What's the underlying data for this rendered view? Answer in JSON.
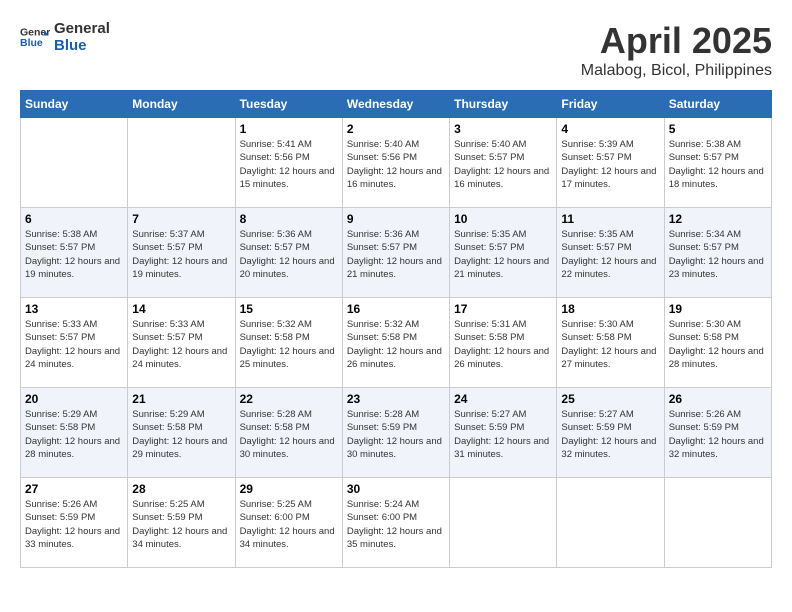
{
  "header": {
    "logo_line1": "General",
    "logo_line2": "Blue",
    "month_year": "April 2025",
    "location": "Malabog, Bicol, Philippines"
  },
  "weekdays": [
    "Sunday",
    "Monday",
    "Tuesday",
    "Wednesday",
    "Thursday",
    "Friday",
    "Saturday"
  ],
  "weeks": [
    [
      {
        "day": "",
        "sunrise": "",
        "sunset": "",
        "daylight": ""
      },
      {
        "day": "",
        "sunrise": "",
        "sunset": "",
        "daylight": ""
      },
      {
        "day": "1",
        "sunrise": "Sunrise: 5:41 AM",
        "sunset": "Sunset: 5:56 PM",
        "daylight": "Daylight: 12 hours and 15 minutes."
      },
      {
        "day": "2",
        "sunrise": "Sunrise: 5:40 AM",
        "sunset": "Sunset: 5:56 PM",
        "daylight": "Daylight: 12 hours and 16 minutes."
      },
      {
        "day": "3",
        "sunrise": "Sunrise: 5:40 AM",
        "sunset": "Sunset: 5:57 PM",
        "daylight": "Daylight: 12 hours and 16 minutes."
      },
      {
        "day": "4",
        "sunrise": "Sunrise: 5:39 AM",
        "sunset": "Sunset: 5:57 PM",
        "daylight": "Daylight: 12 hours and 17 minutes."
      },
      {
        "day": "5",
        "sunrise": "Sunrise: 5:38 AM",
        "sunset": "Sunset: 5:57 PM",
        "daylight": "Daylight: 12 hours and 18 minutes."
      }
    ],
    [
      {
        "day": "6",
        "sunrise": "Sunrise: 5:38 AM",
        "sunset": "Sunset: 5:57 PM",
        "daylight": "Daylight: 12 hours and 19 minutes."
      },
      {
        "day": "7",
        "sunrise": "Sunrise: 5:37 AM",
        "sunset": "Sunset: 5:57 PM",
        "daylight": "Daylight: 12 hours and 19 minutes."
      },
      {
        "day": "8",
        "sunrise": "Sunrise: 5:36 AM",
        "sunset": "Sunset: 5:57 PM",
        "daylight": "Daylight: 12 hours and 20 minutes."
      },
      {
        "day": "9",
        "sunrise": "Sunrise: 5:36 AM",
        "sunset": "Sunset: 5:57 PM",
        "daylight": "Daylight: 12 hours and 21 minutes."
      },
      {
        "day": "10",
        "sunrise": "Sunrise: 5:35 AM",
        "sunset": "Sunset: 5:57 PM",
        "daylight": "Daylight: 12 hours and 21 minutes."
      },
      {
        "day": "11",
        "sunrise": "Sunrise: 5:35 AM",
        "sunset": "Sunset: 5:57 PM",
        "daylight": "Daylight: 12 hours and 22 minutes."
      },
      {
        "day": "12",
        "sunrise": "Sunrise: 5:34 AM",
        "sunset": "Sunset: 5:57 PM",
        "daylight": "Daylight: 12 hours and 23 minutes."
      }
    ],
    [
      {
        "day": "13",
        "sunrise": "Sunrise: 5:33 AM",
        "sunset": "Sunset: 5:57 PM",
        "daylight": "Daylight: 12 hours and 24 minutes."
      },
      {
        "day": "14",
        "sunrise": "Sunrise: 5:33 AM",
        "sunset": "Sunset: 5:57 PM",
        "daylight": "Daylight: 12 hours and 24 minutes."
      },
      {
        "day": "15",
        "sunrise": "Sunrise: 5:32 AM",
        "sunset": "Sunset: 5:58 PM",
        "daylight": "Daylight: 12 hours and 25 minutes."
      },
      {
        "day": "16",
        "sunrise": "Sunrise: 5:32 AM",
        "sunset": "Sunset: 5:58 PM",
        "daylight": "Daylight: 12 hours and 26 minutes."
      },
      {
        "day": "17",
        "sunrise": "Sunrise: 5:31 AM",
        "sunset": "Sunset: 5:58 PM",
        "daylight": "Daylight: 12 hours and 26 minutes."
      },
      {
        "day": "18",
        "sunrise": "Sunrise: 5:30 AM",
        "sunset": "Sunset: 5:58 PM",
        "daylight": "Daylight: 12 hours and 27 minutes."
      },
      {
        "day": "19",
        "sunrise": "Sunrise: 5:30 AM",
        "sunset": "Sunset: 5:58 PM",
        "daylight": "Daylight: 12 hours and 28 minutes."
      }
    ],
    [
      {
        "day": "20",
        "sunrise": "Sunrise: 5:29 AM",
        "sunset": "Sunset: 5:58 PM",
        "daylight": "Daylight: 12 hours and 28 minutes."
      },
      {
        "day": "21",
        "sunrise": "Sunrise: 5:29 AM",
        "sunset": "Sunset: 5:58 PM",
        "daylight": "Daylight: 12 hours and 29 minutes."
      },
      {
        "day": "22",
        "sunrise": "Sunrise: 5:28 AM",
        "sunset": "Sunset: 5:58 PM",
        "daylight": "Daylight: 12 hours and 30 minutes."
      },
      {
        "day": "23",
        "sunrise": "Sunrise: 5:28 AM",
        "sunset": "Sunset: 5:59 PM",
        "daylight": "Daylight: 12 hours and 30 minutes."
      },
      {
        "day": "24",
        "sunrise": "Sunrise: 5:27 AM",
        "sunset": "Sunset: 5:59 PM",
        "daylight": "Daylight: 12 hours and 31 minutes."
      },
      {
        "day": "25",
        "sunrise": "Sunrise: 5:27 AM",
        "sunset": "Sunset: 5:59 PM",
        "daylight": "Daylight: 12 hours and 32 minutes."
      },
      {
        "day": "26",
        "sunrise": "Sunrise: 5:26 AM",
        "sunset": "Sunset: 5:59 PM",
        "daylight": "Daylight: 12 hours and 32 minutes."
      }
    ],
    [
      {
        "day": "27",
        "sunrise": "Sunrise: 5:26 AM",
        "sunset": "Sunset: 5:59 PM",
        "daylight": "Daylight: 12 hours and 33 minutes."
      },
      {
        "day": "28",
        "sunrise": "Sunrise: 5:25 AM",
        "sunset": "Sunset: 5:59 PM",
        "daylight": "Daylight: 12 hours and 34 minutes."
      },
      {
        "day": "29",
        "sunrise": "Sunrise: 5:25 AM",
        "sunset": "Sunset: 6:00 PM",
        "daylight": "Daylight: 12 hours and 34 minutes."
      },
      {
        "day": "30",
        "sunrise": "Sunrise: 5:24 AM",
        "sunset": "Sunset: 6:00 PM",
        "daylight": "Daylight: 12 hours and 35 minutes."
      },
      {
        "day": "",
        "sunrise": "",
        "sunset": "",
        "daylight": ""
      },
      {
        "day": "",
        "sunrise": "",
        "sunset": "",
        "daylight": ""
      },
      {
        "day": "",
        "sunrise": "",
        "sunset": "",
        "daylight": ""
      }
    ]
  ]
}
